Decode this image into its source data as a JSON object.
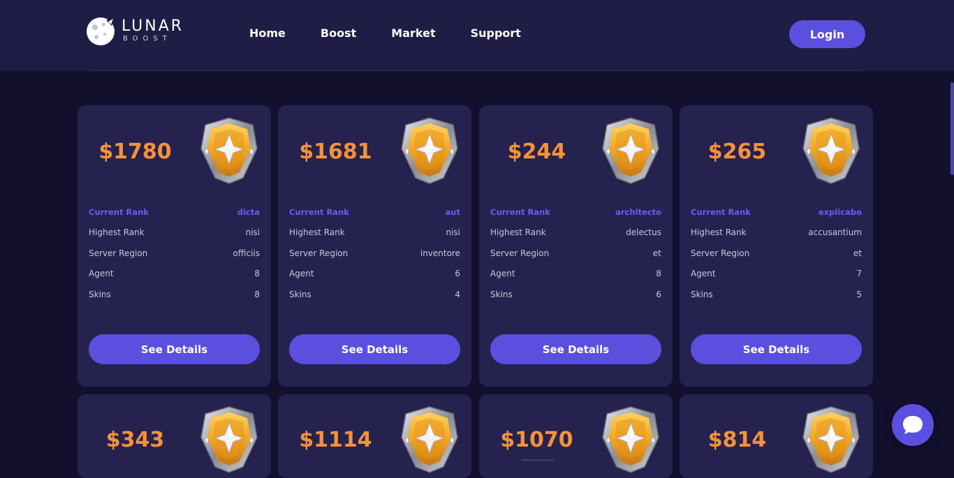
{
  "brand": {
    "name": "LUNAR",
    "sub": "BOOST"
  },
  "nav": {
    "items": [
      "Home",
      "Boost",
      "Market",
      "Support"
    ],
    "login_label": "Login"
  },
  "colors": {
    "background": "#12102d",
    "header": "#1f1c45",
    "card": "#26224f",
    "accent": "#5b4fe0",
    "price": "#f6923a",
    "rank_label": "#6a5cf2"
  },
  "row_labels": {
    "current_rank": "Current Rank",
    "highest_rank": "Highest Rank",
    "server_region": "Server Region",
    "agent": "Agent",
    "skins": "Skins"
  },
  "details_label": "See Details",
  "listings": [
    {
      "price": "$1780",
      "current_rank": "dicta",
      "highest_rank": "nisi",
      "server_region": "officiis",
      "agent": "8",
      "skins": "8",
      "badge_icon": "gold-rank-badge-icon"
    },
    {
      "price": "$1681",
      "current_rank": "aut",
      "highest_rank": "nisi",
      "server_region": "inventore",
      "agent": "6",
      "skins": "4",
      "badge_icon": "gold-rank-badge-icon"
    },
    {
      "price": "$244",
      "current_rank": "architecto",
      "highest_rank": "delectus",
      "server_region": "et",
      "agent": "8",
      "skins": "6",
      "badge_icon": "gold-rank-badge-icon"
    },
    {
      "price": "$265",
      "current_rank": "explicabo",
      "highest_rank": "accusantium",
      "server_region": "et",
      "agent": "7",
      "skins": "5",
      "badge_icon": "gold-rank-badge-icon"
    },
    {
      "price": "$343",
      "badge_icon": "gold-rank-badge-icon"
    },
    {
      "price": "$1114",
      "badge_icon": "gold-rank-badge-icon"
    },
    {
      "price": "$1070",
      "badge_icon": "gold-rank-badge-icon"
    },
    {
      "price": "$814",
      "badge_icon": "gold-rank-badge-icon"
    }
  ],
  "chat": {
    "icon": "chat-bubble-icon"
  }
}
